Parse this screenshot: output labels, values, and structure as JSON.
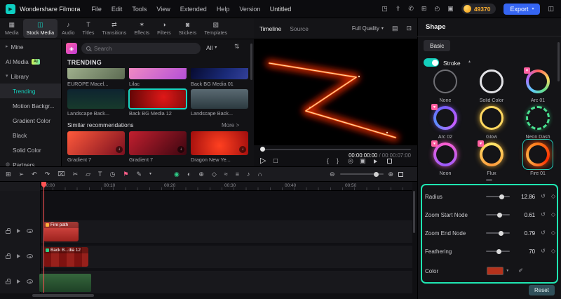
{
  "titlebar": {
    "app_name": "Wondershare Filmora",
    "menus": [
      "File",
      "Edit",
      "Tools",
      "View",
      "Extended",
      "Help",
      "Version"
    ],
    "project_title": "Untitled",
    "coins": "49370",
    "export_label": "Export"
  },
  "ribbon": {
    "tabs": [
      {
        "label": "Media"
      },
      {
        "label": "Stock Media"
      },
      {
        "label": "Audio"
      },
      {
        "label": "Titles"
      },
      {
        "label": "Transitions"
      },
      {
        "label": "Effects"
      },
      {
        "label": "Filters"
      },
      {
        "label": "Stickers"
      },
      {
        "label": "Templates"
      }
    ],
    "selected": "Stock Media"
  },
  "sidebar": {
    "mine": "Mine",
    "ai_media": "AI Media",
    "ai_badge": "AI",
    "library": "Library",
    "library_items": [
      "Trending",
      "Motion Backgr...",
      "Gradient Color",
      "Black",
      "Solid Color"
    ],
    "selected": "Trending",
    "partners": "Partners"
  },
  "media": {
    "search_placeholder": "Search",
    "all_label": "All",
    "section_title": "TRENDING",
    "row1": [
      {
        "caption": "EUROPE Macel..."
      },
      {
        "caption": "Lilac"
      },
      {
        "caption": "Back BG Media 01"
      }
    ],
    "row2": [
      {
        "caption": "Landscape Back..."
      },
      {
        "caption": "Back BG Media 12"
      },
      {
        "caption": "Landscape Back..."
      }
    ],
    "selected_item": "Back BG Media 12",
    "similar": {
      "title": "Similar recommendations",
      "more_label": "More >",
      "items": [
        {
          "caption": "Gradient 7"
        },
        {
          "caption": "Gradient 7"
        },
        {
          "caption": "Dragon New Ye..."
        }
      ]
    }
  },
  "preview": {
    "tabs": [
      "Timeline",
      "Source"
    ],
    "selected_tab": "Timeline",
    "quality": "Full Quality",
    "time_current": "00:00:00:00",
    "time_separator": "/",
    "time_total": "00:00:07:00"
  },
  "shape": {
    "title": "Shape",
    "tab": "Basic",
    "stroke_label": "Stroke",
    "stroke_enabled": true,
    "presets": [
      {
        "name": "None"
      },
      {
        "name": "Solid Color"
      },
      {
        "name": "Arc 01",
        "badge": true
      },
      {
        "name": "Arc 02",
        "badge": true
      },
      {
        "name": "Glow"
      },
      {
        "name": "Neon Dash"
      },
      {
        "name": "Neon",
        "badge": true
      },
      {
        "name": "Flux",
        "badge": true
      },
      {
        "name": "Fire 01",
        "selected": true
      }
    ],
    "selected_preset": "Fire 01",
    "params": [
      {
        "label": "Radius",
        "value": "12.86"
      },
      {
        "label": "Zoom Start Node",
        "value": "0.61"
      },
      {
        "label": "Zoom End Node",
        "value": "0.79"
      },
      {
        "label": "Feathering",
        "value": "70"
      }
    ],
    "color_label": "Color",
    "color_value": "#b5321c",
    "reset_label": "Reset"
  },
  "timeline": {
    "ruler_labels": [
      "00:00",
      "00:10",
      "00:20",
      "00:30",
      "00:40",
      "00:50"
    ],
    "clips": [
      {
        "label": "Fire path"
      },
      {
        "label": "Back B...dia 12"
      }
    ]
  },
  "colors": {
    "accent_teal": "#17d4c1",
    "highlight_teal": "#1fe6b2",
    "export_blue": "#3565f2",
    "coin_orange": "#ffb02e",
    "clip_red": "#b5321c"
  },
  "icons": {
    "logo_play": "▶",
    "chevron_right": "▸",
    "chevron_down": "▾",
    "chevron_up": "▴",
    "gift": "◳",
    "share": "⇪",
    "phone": "✆",
    "invite": "⊞",
    "clock": "◴",
    "monitor": "▣",
    "layout": "◫",
    "provider": "◈",
    "sort": "⇅",
    "download": "↓",
    "heart": "♥",
    "partners": "◍",
    "tab_media": "▦",
    "tab_stock": "◫",
    "tab_audio": "♪",
    "tab_titles": "T",
    "tab_transitions": "⇄",
    "tab_effects": "✶",
    "tab_filters": "◑",
    "tab_stickers": "◙",
    "tab_templates": "▧",
    "grid_view": "▤",
    "compare": "⊡",
    "play": "▷",
    "stop": "□",
    "mark_in": "{",
    "mark_out": "}",
    "snapshot": "◎",
    "render": "▣",
    "reset_param": "↺",
    "keyframe": "◇",
    "dropper": "✐",
    "tl_grid": "⊞",
    "tl_select": "➢",
    "tl_undo": "↶",
    "tl_redo": "↷",
    "tl_delete": "⌧",
    "tl_split": "✂",
    "tl_crop": "▱",
    "tl_text": "T",
    "tl_speed": "◷",
    "tl_marker": "⚑",
    "tl_pen": "✎",
    "tl_more": "▾",
    "tl_chroma": "◉",
    "tl_mask": "◐",
    "tl_track": "⊕",
    "tl_keyframe": "◇",
    "tl_ramp": "≈",
    "tl_mixer": "≡",
    "tl_voice": "♪",
    "tl_snap": "∩",
    "tl_zoom_out": "⊖",
    "tl_zoom_in": "⊕"
  }
}
